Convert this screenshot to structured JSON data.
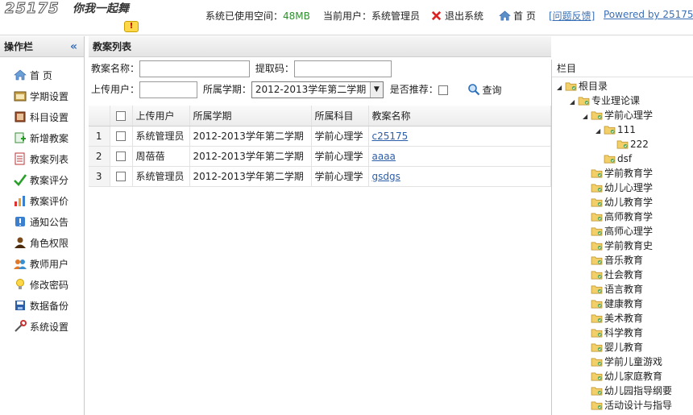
{
  "header": {
    "logo_text": "25175",
    "logo_slogan": "你我一起舞",
    "space_label": "系统已使用空间：",
    "space_value": "48MB",
    "user_label": "当前用户：",
    "user_value": "系统管理员",
    "logout": "退出系统",
    "home": "首 页",
    "feedback": "[问题反馈]",
    "powered": "Powered by 25175"
  },
  "sidebar": {
    "title": "操作栏",
    "collapse": "«",
    "items": [
      {
        "label": "首 页",
        "icon": "home-icon"
      },
      {
        "label": "学期设置",
        "icon": "calendar-icon"
      },
      {
        "label": "科目设置",
        "icon": "book-icon"
      },
      {
        "label": "新增教案",
        "icon": "add-doc-icon"
      },
      {
        "label": "教案列表",
        "icon": "list-icon"
      },
      {
        "label": "教案评分",
        "icon": "check-icon"
      },
      {
        "label": "教案评价",
        "icon": "chart-icon"
      },
      {
        "label": "通知公告",
        "icon": "notice-icon"
      },
      {
        "label": "角色权限",
        "icon": "user-icon"
      },
      {
        "label": "教师用户",
        "icon": "users-icon"
      },
      {
        "label": "修改密码",
        "icon": "bulb-icon"
      },
      {
        "label": "数据备份",
        "icon": "disk-icon"
      },
      {
        "label": "系统设置",
        "icon": "tools-icon"
      }
    ]
  },
  "main": {
    "title": "教案列表",
    "filters": {
      "name_label": "教案名称：",
      "name_value": "",
      "code_label": "提取码：",
      "code_value": "",
      "uploader_label": "上传用户：",
      "uploader_value": "",
      "term_label": "所属学期：",
      "term_value": "2012-2013学年第二学期",
      "recommend_label": "是否推荐：",
      "query": "查询"
    },
    "columns": [
      "上传用户",
      "所属学期",
      "所属科目",
      "教案名称"
    ],
    "rows": [
      {
        "num": "1",
        "uploader": "系统管理员",
        "term": "2012-2013学年第二学期",
        "subject": "学前心理学",
        "name": "c25175"
      },
      {
        "num": "2",
        "uploader": "周蓓蓓",
        "term": "2012-2013学年第二学期",
        "subject": "学前心理学",
        "name": "aaaa"
      },
      {
        "num": "3",
        "uploader": "系统管理员",
        "term": "2012-2013学年第二学期",
        "subject": "学前心理学",
        "name": "gsdgs"
      }
    ]
  },
  "tree": {
    "title": "栏目",
    "nodes": [
      {
        "label": "根目录",
        "toggle": "◢"
      },
      {
        "label": "专业理论课",
        "toggle": "◢"
      },
      {
        "label": "学前心理学",
        "toggle": "◢"
      },
      {
        "label": "111",
        "toggle": "◢"
      },
      {
        "label": "222",
        "toggle": ""
      },
      {
        "label": "dsf",
        "toggle": ""
      },
      {
        "label": "学前教育学",
        "toggle": ""
      },
      {
        "label": "幼儿心理学",
        "toggle": ""
      },
      {
        "label": "幼儿教育学",
        "toggle": ""
      },
      {
        "label": "高师教育学",
        "toggle": ""
      },
      {
        "label": "高师心理学",
        "toggle": ""
      },
      {
        "label": "学前教育史",
        "toggle": ""
      },
      {
        "label": "音乐教育",
        "toggle": ""
      },
      {
        "label": "社会教育",
        "toggle": ""
      },
      {
        "label": "语言教育",
        "toggle": ""
      },
      {
        "label": "健康教育",
        "toggle": ""
      },
      {
        "label": "美术教育",
        "toggle": ""
      },
      {
        "label": "科学教育",
        "toggle": ""
      },
      {
        "label": "婴儿教育",
        "toggle": ""
      },
      {
        "label": "学前儿童游戏",
        "toggle": ""
      },
      {
        "label": "幼儿家庭教育",
        "toggle": ""
      },
      {
        "label": "幼儿园指导纲要",
        "toggle": ""
      },
      {
        "label": "活动设计与指导",
        "toggle": ""
      }
    ]
  }
}
